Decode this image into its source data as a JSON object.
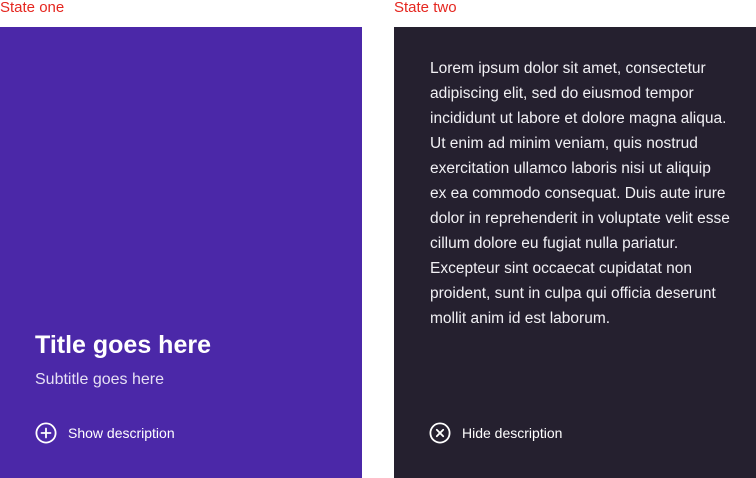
{
  "states": {
    "one": {
      "label": "State one",
      "card": {
        "title": "Title goes here",
        "subtitle": "Subtitle goes here",
        "toggle_label": "Show description",
        "toggle_icon": "plus-circle-icon",
        "background": "#4b28a8"
      }
    },
    "two": {
      "label": "State two",
      "card": {
        "description": "Lorem ipsum dolor sit amet, consectetur adipiscing elit, sed do eiusmod tempor incididunt ut labore et dolore magna aliqua. Ut enim ad minim veniam, quis nostrud exercitation ullamco laboris nisi ut aliquip ex ea commodo consequat. Duis aute irure dolor in reprehenderit in voluptate velit esse cillum dolore eu fugiat nulla pariatur. Excepteur sint occaecat cupidatat non proident, sunt in culpa qui officia deserunt mollit anim id est laborum.",
        "toggle_label": "Hide description",
        "toggle_icon": "close-circle-icon",
        "background": "#25202f"
      }
    }
  },
  "colors": {
    "state_label": "#e5261f",
    "text": "#ffffff"
  }
}
